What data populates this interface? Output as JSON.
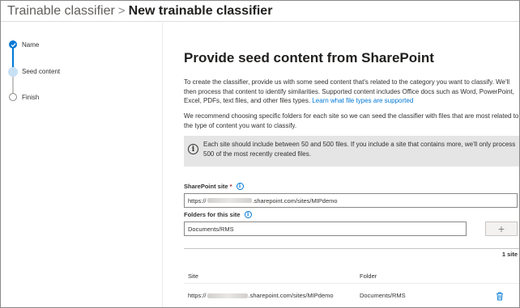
{
  "header": {
    "parent": "Trainable classifier",
    "separator": ">",
    "current": "New trainable classifier"
  },
  "stepper": {
    "steps": [
      {
        "label": "Name",
        "state": "done"
      },
      {
        "label": "Seed content",
        "state": "current"
      },
      {
        "label": "Finish",
        "state": "future"
      }
    ]
  },
  "main": {
    "title": "Provide seed content from SharePoint",
    "intro": "To create the classifier, provide us with some seed content that's related to the category you want to classify. We'll then process that content to identify similarities. Supported content includes Office docs such as Word, PowerPoint, Excel, PDFs, text files, and other files types.",
    "intro_link": "Learn what file types are supported",
    "recommend": "We recommend choosing specific folders for each site so we can seed the classifier with files that are most related to the type of content you want to classify.",
    "info": "Each site should include between 50 and 500 files. If you include a site that contains more, we'll only process 500 of the most recently created files.",
    "sharepoint_site": {
      "label": "SharePoint site",
      "required_mark": "*",
      "value_prefix": "https://",
      "value_suffix": ".sharepoint.com/sites/MIPdemo"
    },
    "folders": {
      "label": "Folders for this site",
      "value": "Documents/RMS",
      "add_label": "+"
    },
    "site_count": "1 site",
    "table": {
      "headers": [
        "Site",
        "Folder"
      ],
      "rows": [
        {
          "site_prefix": "https://",
          "site_suffix": ".sharepoint.com/sites/MIPdemo",
          "folder": "Documents/RMS"
        }
      ]
    }
  },
  "colors": {
    "accent": "#0078d4",
    "info_bg": "#e5e5e5",
    "required": "#a4262c"
  }
}
